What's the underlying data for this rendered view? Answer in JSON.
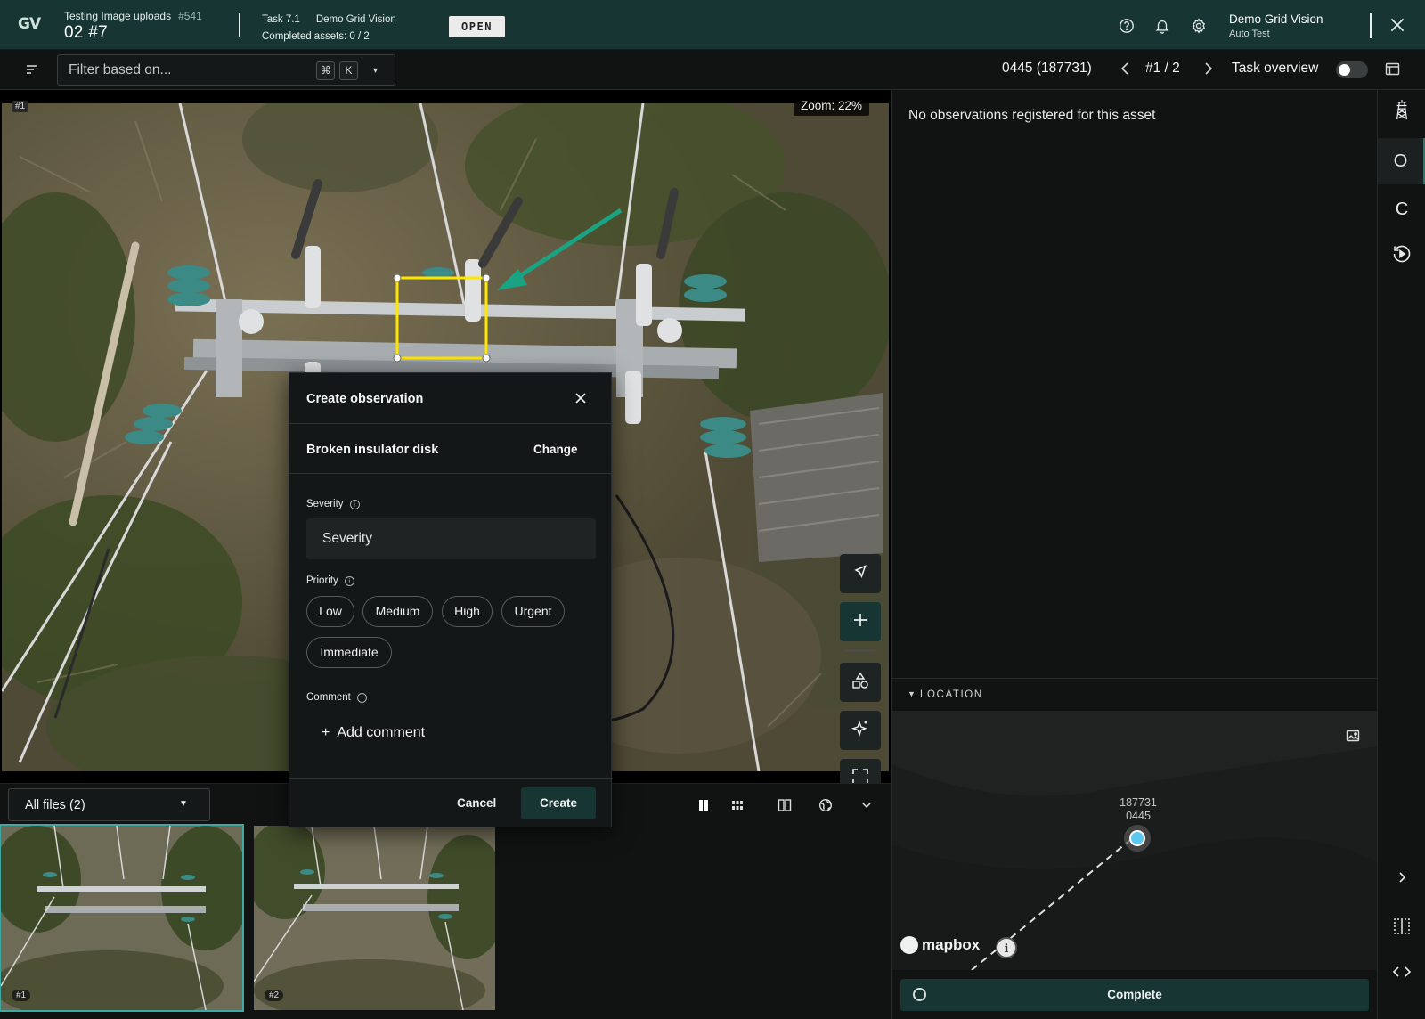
{
  "topbar": {
    "logo": "GV",
    "project_name": "Testing Image uploads",
    "project_hash": "#541",
    "project_sub": "02  #7",
    "task_label": "Task 7.1",
    "task_project": "Demo Grid Vision",
    "completed_assets": "Completed assets: 0 / 2",
    "status_badge": "OPEN",
    "user_name": "Demo Grid Vision",
    "user_role": "Auto Test",
    "icons": [
      "help-icon",
      "bell-icon",
      "gear-icon",
      "close-icon"
    ]
  },
  "toolbar": {
    "filter_placeholder": "Filter based on...",
    "shortcut_cmd": "⌘",
    "shortcut_key": "K",
    "asset_id": "0445 (187731)",
    "pager": "#1 / 2",
    "task_overview_label": "Task overview",
    "task_overview_on": false
  },
  "viewer": {
    "image_number": "#1",
    "zoom": "Zoom: 22%",
    "bbox_color": "#ffe600",
    "arrow_color": "#1aa383",
    "tools": [
      "select-icon",
      "plus-icon",
      "shapes-icon",
      "ai-sparkle-icon",
      "fullscreen-icon",
      "gear-icon"
    ]
  },
  "strip": {
    "files_select": "All files (2)",
    "thumbnails": [
      {
        "label": "#1",
        "selected": true
      },
      {
        "label": "#2",
        "selected": false
      }
    ]
  },
  "dialog": {
    "title": "Create observation",
    "observation_type": "Broken insulator disk",
    "change_label": "Change",
    "severity_label": "Severity",
    "severity_placeholder": "Severity",
    "priority_label": "Priority",
    "priorities": [
      "Low",
      "Medium",
      "High",
      "Urgent",
      "Immediate"
    ],
    "comment_label": "Comment",
    "add_comment": "Add comment",
    "cancel_label": "Cancel",
    "create_label": "Create"
  },
  "panel": {
    "empty_message": "No observations registered for this asset",
    "location_header": "LOCATION",
    "map_label_line1": "187731",
    "map_label_line2": "0445",
    "map_attribution": "mapbox",
    "complete_label": "Complete"
  },
  "rail": {
    "items": [
      "tower-icon",
      "O",
      "C",
      "history-icon"
    ],
    "selected": "O"
  }
}
